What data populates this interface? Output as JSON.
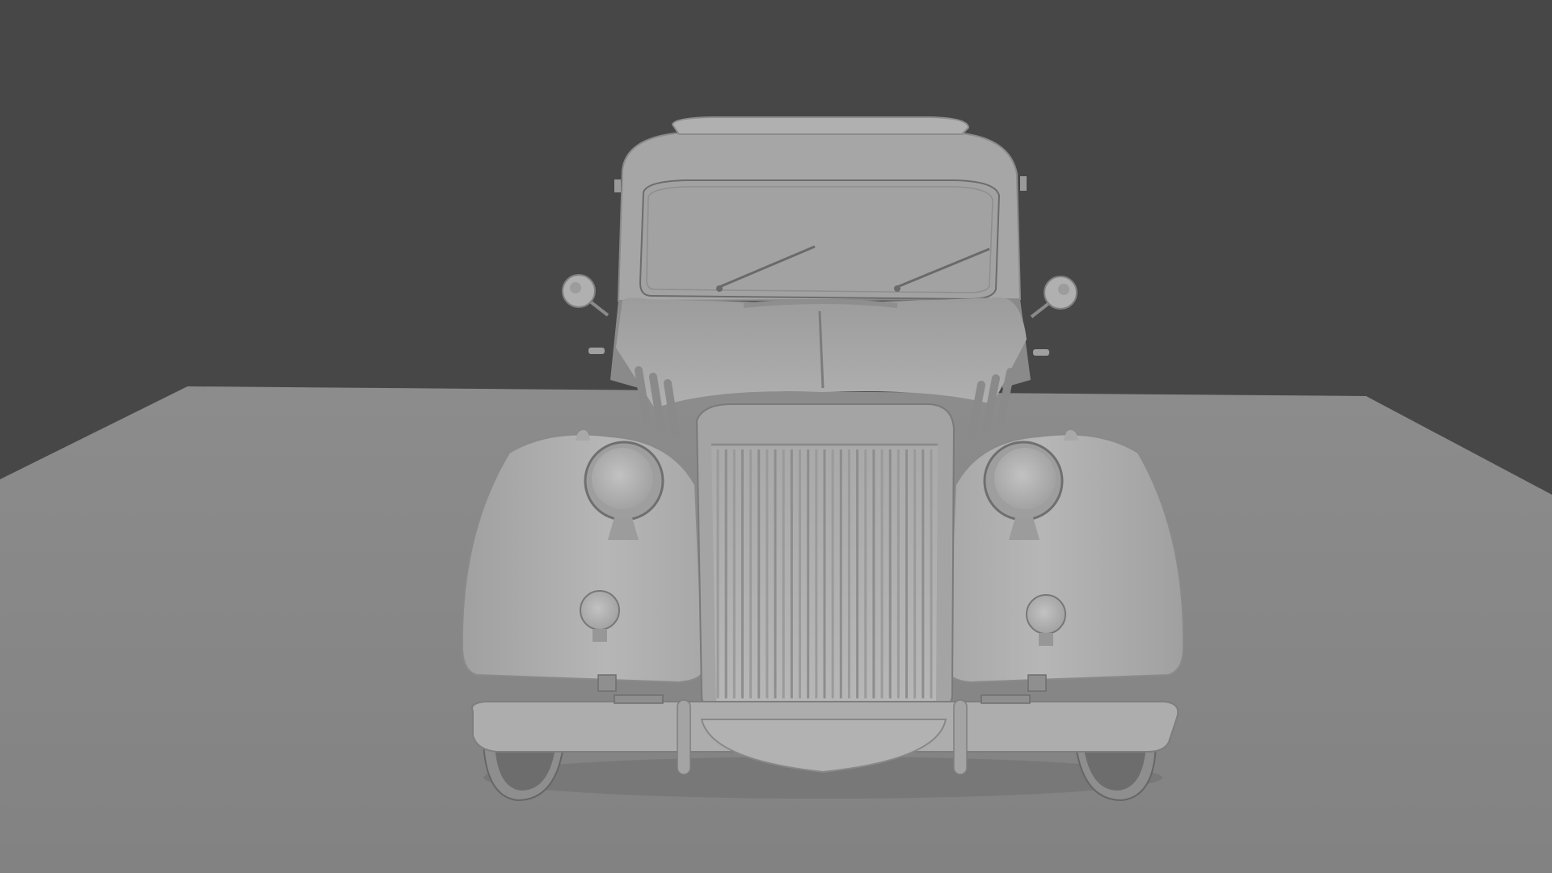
{
  "scene": {
    "subject": "vintage-car-front",
    "render_style": "clay",
    "colors": {
      "background": "#474747",
      "floor": "#8a8a8a",
      "body": "#a4a4a4",
      "body_light": "#b4b4b4",
      "body_shadow": "#7a7a7a",
      "line": "#5e5e5e"
    }
  }
}
